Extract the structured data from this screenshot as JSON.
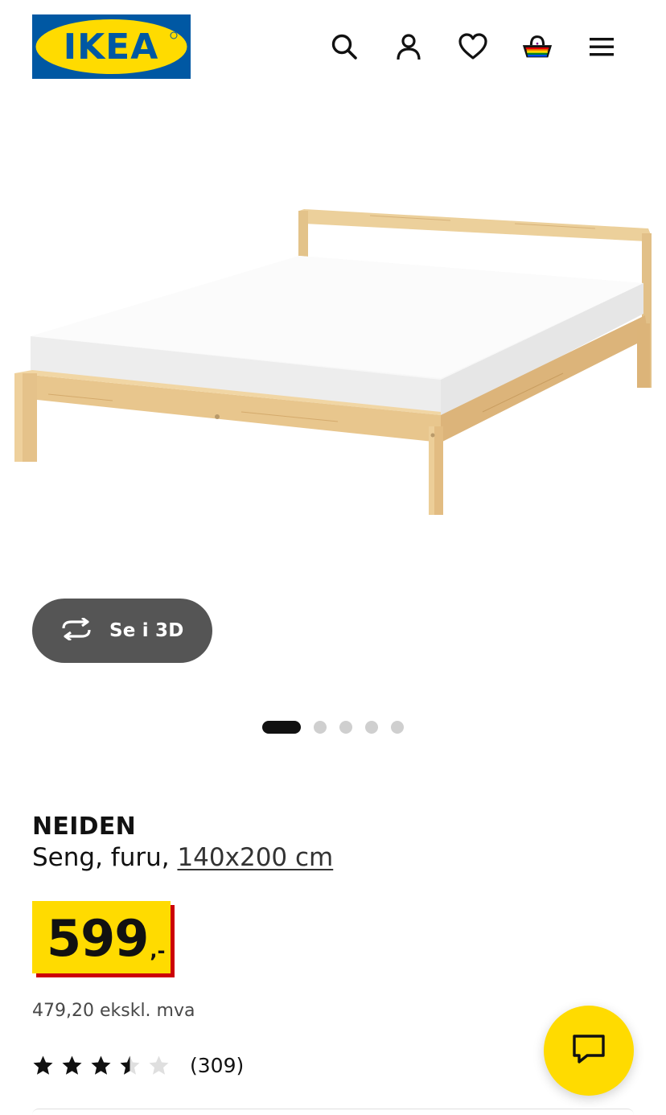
{
  "brand": {
    "logo_text": "IKEA",
    "colors": {
      "blue": "#0058a3",
      "yellow": "#ffdb00",
      "red": "#cc0008"
    }
  },
  "header": {
    "icons": [
      "search-icon",
      "account-icon",
      "heart-icon",
      "shopping-bag-icon",
      "menu-icon"
    ]
  },
  "gallery": {
    "view_3d_label": "Se i 3D",
    "image_count": 5,
    "active_index": 0
  },
  "product": {
    "name": "NEIDEN",
    "description": "Seng, furu, ",
    "size": "140x200 cm",
    "price": "599",
    "price_suffix": ",-",
    "price_excl_vat": "479,20 ekskl. mva",
    "rating": 3.5,
    "rating_max": 5,
    "rating_count": "(309)"
  },
  "chat": {
    "icon": "chat-icon"
  }
}
